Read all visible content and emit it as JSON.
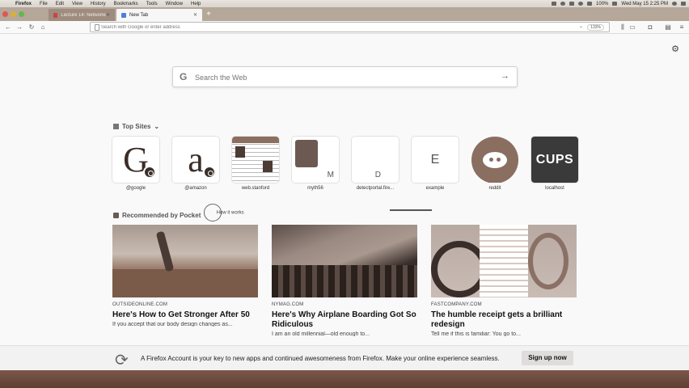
{
  "menubar": {
    "app": "Firefox",
    "items": [
      "File",
      "Edit",
      "View",
      "History",
      "Bookmarks",
      "Tools",
      "Window",
      "Help"
    ],
    "battery": "100%",
    "clock": "Wed May 15  2:25 PM"
  },
  "tabs": [
    {
      "label": "Lecture 14: Networking - Winter",
      "active": false
    },
    {
      "label": "New Tab",
      "active": true
    }
  ],
  "urlbar": {
    "placeholder": "Search with Google or enter address",
    "zoom": "133%"
  },
  "search": {
    "placeholder": "Search the Web"
  },
  "top_sites": {
    "heading": "Top Sites",
    "items": [
      {
        "label": "@google",
        "glyph": "G"
      },
      {
        "label": "@amazon",
        "glyph": "a"
      },
      {
        "label": "web.stanford",
        "glyph": ""
      },
      {
        "label": "myth56",
        "glyph": "M"
      },
      {
        "label": "detectportal.fire...",
        "glyph": "D"
      },
      {
        "label": "example",
        "glyph": "E"
      },
      {
        "label": "reddit",
        "glyph": ""
      },
      {
        "label": "localhost",
        "glyph": "CUPS"
      }
    ]
  },
  "pocket": {
    "heading": "Recommended by Pocket",
    "how_it_works": "How it works",
    "stories": [
      {
        "source": "OUTSIDEONLINE.COM",
        "title": "Here's How to Get Stronger After 50",
        "snippet": "If you accept that our body design changes as..."
      },
      {
        "source": "NYMAG.COM",
        "title": "Here's Why Airplane Boarding Got So Ridiculous",
        "snippet": "I am an old millennial—old enough to..."
      },
      {
        "source": "FASTCOMPANY.COM",
        "title": "The humble receipt gets a brilliant redesign",
        "snippet": "Tell me if this is familiar: You go to..."
      }
    ]
  },
  "signup_bar": {
    "message": "A Firefox Account is your key to new apps and continued awesomeness from Firefox. Make your online experience seamless.",
    "button": "Sign up now"
  },
  "colors": {
    "menubar": "#e0dbd4",
    "tabstrip": "#b5a79a",
    "content_bg": "#f9f9fa"
  }
}
